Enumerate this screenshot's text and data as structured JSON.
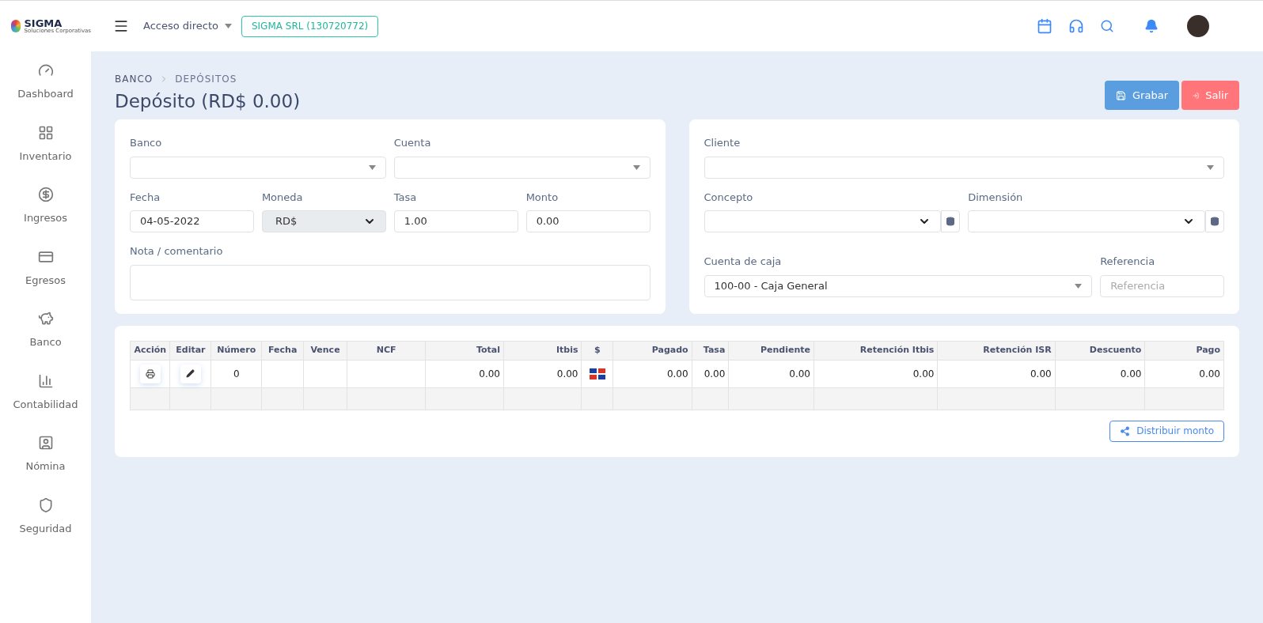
{
  "header": {
    "logo": {
      "name": "SIGMA",
      "tagline": "Soluciones Corporativas"
    },
    "shortcut": "Acceso directo",
    "company": "SIGMA SRL (130720772)"
  },
  "sidebar": {
    "items": [
      {
        "label": "Dashboard",
        "kind": "gauge"
      },
      {
        "label": "Inventario",
        "kind": "grid"
      },
      {
        "label": "Ingresos",
        "kind": "dollar"
      },
      {
        "label": "Egresos",
        "kind": "card"
      },
      {
        "label": "Banco",
        "kind": "piggy"
      },
      {
        "label": "Contabilidad",
        "kind": "chart"
      },
      {
        "label": "Nómina",
        "kind": "badge"
      },
      {
        "label": "Seguridad",
        "kind": "shield"
      }
    ]
  },
  "breadcrumb": [
    "BANCO",
    "DEPÓSITOS"
  ],
  "title": "Depósito (RD$ 0.00)",
  "actions": [
    {
      "label": "Grabar",
      "kind": "save"
    },
    {
      "label": "Salir",
      "kind": "exit"
    }
  ],
  "left_form": {
    "fields": [
      {
        "label": "Banco",
        "kind": "select"
      },
      {
        "label": "Cuenta",
        "kind": "select"
      },
      {
        "label": "Fecha",
        "kind": "input",
        "value": "04-05-2022"
      },
      {
        "label": "Moneda",
        "kind": "native",
        "value": "RD$",
        "disabled": true
      },
      {
        "label": "Tasa",
        "kind": "input",
        "value": "1.00"
      },
      {
        "label": "Monto",
        "kind": "input",
        "value": "0.00"
      },
      {
        "label": "Nota / comentario",
        "kind": "textarea"
      }
    ]
  },
  "right_form": {
    "fields": [
      {
        "label": "Cliente",
        "kind": "select"
      },
      {
        "label": "Concepto",
        "kind": "native_addon"
      },
      {
        "label": "Dimensión",
        "kind": "native_addon"
      },
      {
        "label": "Cuenta de caja",
        "kind": "select",
        "value": "100-00 - Caja General"
      },
      {
        "label": "Referencia",
        "kind": "input",
        "placeholder": "Referencia"
      }
    ]
  },
  "table": {
    "columns": [
      "Acción",
      "Editar",
      "Número",
      "Fecha",
      "Vence",
      "NCF",
      "Total",
      "Itbis",
      "$",
      "Pagado",
      "Tasa",
      "Pendiente",
      "Retención Itbis",
      "Retención ISR",
      "Descuento",
      "Pago"
    ],
    "rows": [
      [
        {
          "kind": "print"
        },
        {
          "kind": "edit"
        },
        {
          "kind": "text",
          "text": "0"
        },
        {
          "kind": "blank"
        },
        {
          "kind": "blank"
        },
        {
          "kind": "blank"
        },
        {
          "kind": "text",
          "text": "0.00"
        },
        {
          "kind": "text",
          "text": "0.00"
        },
        {
          "kind": "flag"
        },
        {
          "kind": "text",
          "text": "0.00"
        },
        {
          "kind": "text",
          "text": "0.00"
        },
        {
          "kind": "text",
          "text": "0.00"
        },
        {
          "kind": "text",
          "text": "0.00"
        },
        {
          "kind": "text",
          "text": "0.00"
        },
        {
          "kind": "text",
          "text": "0.00"
        },
        {
          "kind": "text",
          "text": "0.00"
        }
      ]
    ]
  },
  "distribute_button": "Distribuir monto"
}
